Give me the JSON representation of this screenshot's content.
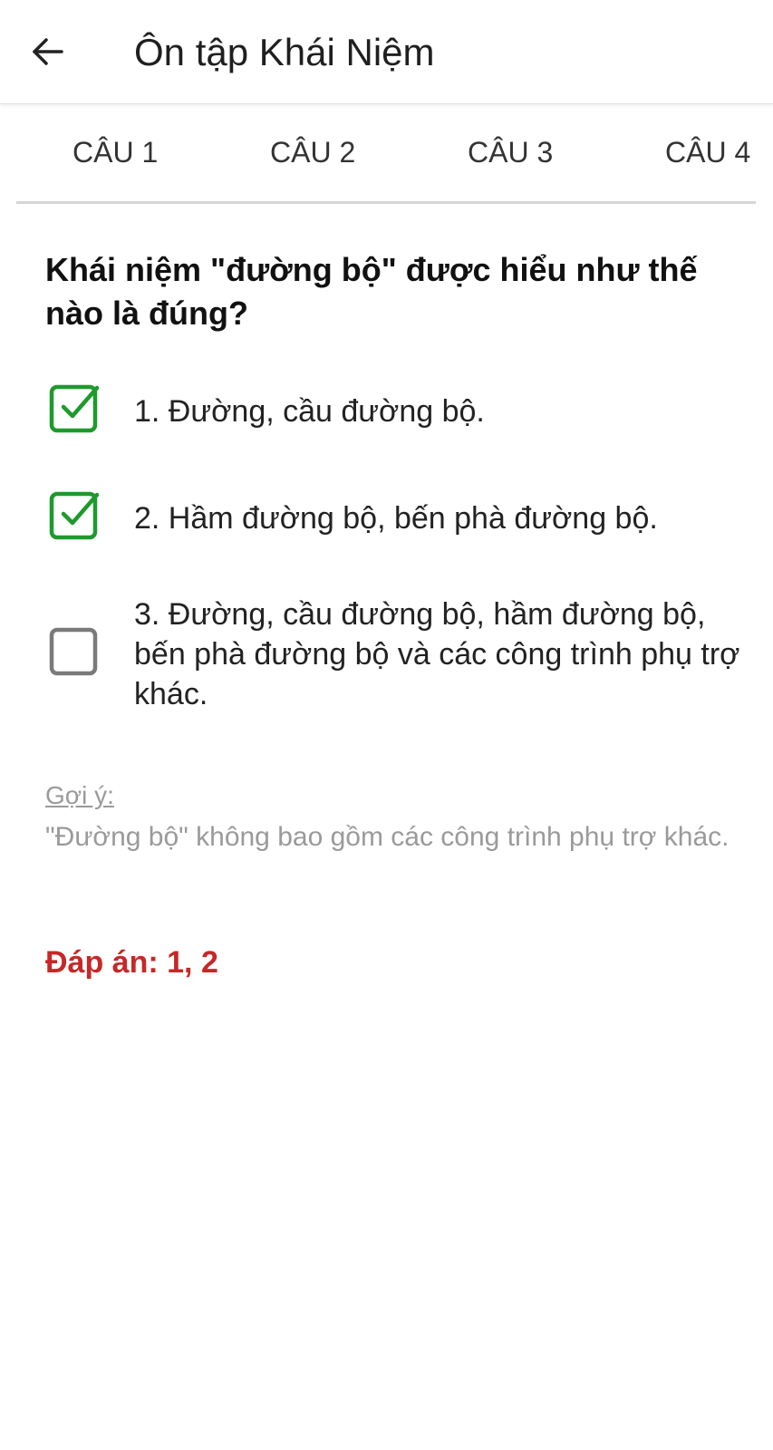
{
  "app_bar": {
    "back_icon": "arrow-left-icon",
    "title": "Ôn tập Khái Niệm"
  },
  "tabs": [
    {
      "label": "CÂU 1"
    },
    {
      "label": "CÂU 2"
    },
    {
      "label": "CÂU 3"
    },
    {
      "label": "CÂU 4"
    }
  ],
  "question": {
    "text": "Khái niệm \"đường bộ\" được hiểu như thế nào là đúng?"
  },
  "options": [
    {
      "label": "1. Đường, cầu đường bộ.",
      "checked": true
    },
    {
      "label": "2. Hầm đường bộ, bến phà đường bộ.",
      "checked": true
    },
    {
      "label": "3. Đường, cầu đường bộ, hầm đường bộ, bến phà đường bộ và các công trình phụ trợ khác.",
      "checked": false
    }
  ],
  "hint": {
    "label": "Gợi ý:",
    "text": "\"Đường bộ\" không bao gồm các công trình phụ trợ khác."
  },
  "answer": {
    "label": "Đáp án:",
    "value": "1, 2"
  },
  "colors": {
    "checked": "#1e9a2c",
    "unchecked": "#7a7a7a",
    "answer": "#c62828",
    "hint": "#9a9a9a"
  }
}
